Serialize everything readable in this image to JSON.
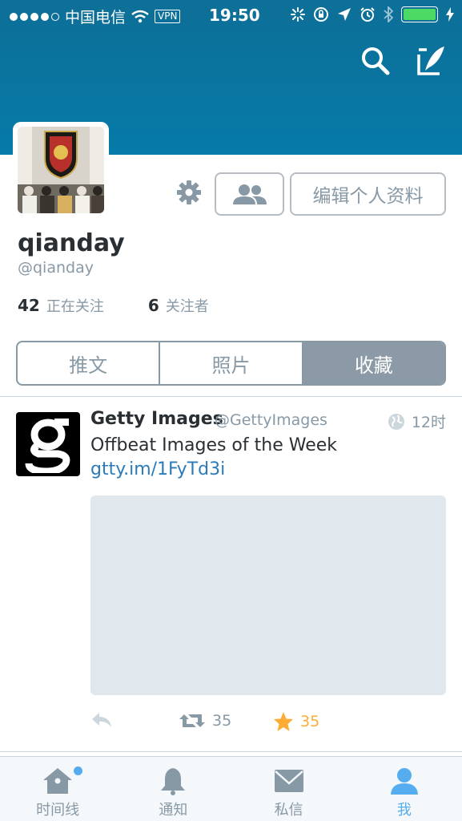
{
  "status_bar": {
    "carrier": "中国电信",
    "vpn": "VPN",
    "time": "19:50",
    "battery_level": 1.0,
    "battery_color": "#4cd964"
  },
  "header": {
    "background_color": "#0d6f97",
    "icons": [
      "search-icon",
      "compose-icon"
    ]
  },
  "profile": {
    "name": "qianday",
    "handle": "@qianday",
    "following_count": "42",
    "following_label": "正在关注",
    "followers_count": "6",
    "followers_label": "关注者",
    "edit_label": "编辑个人资料"
  },
  "tabs": [
    {
      "label": "推文",
      "active": false
    },
    {
      "label": "照片",
      "active": false
    },
    {
      "label": "收藏",
      "active": true
    }
  ],
  "tweet": {
    "author_name": "Getty Images",
    "author_handle": "@GettyImages",
    "time": "12时",
    "text": "Offbeat Images of the Week ",
    "link": "gtty.im/1FyTd3i",
    "retweet_count": "35",
    "favorite_count": "35"
  },
  "tabbar": [
    {
      "label": "时间线",
      "icon": "home-icon",
      "active": false,
      "badge": true
    },
    {
      "label": "通知",
      "icon": "bell-icon",
      "active": false
    },
    {
      "label": "私信",
      "icon": "envelope-icon",
      "active": false
    },
    {
      "label": "我",
      "icon": "person-icon",
      "active": true
    }
  ],
  "colors": {
    "accent": "#55acee",
    "link": "#2b7bb9",
    "favorite": "#ffac33",
    "muted": "#8899a6"
  }
}
